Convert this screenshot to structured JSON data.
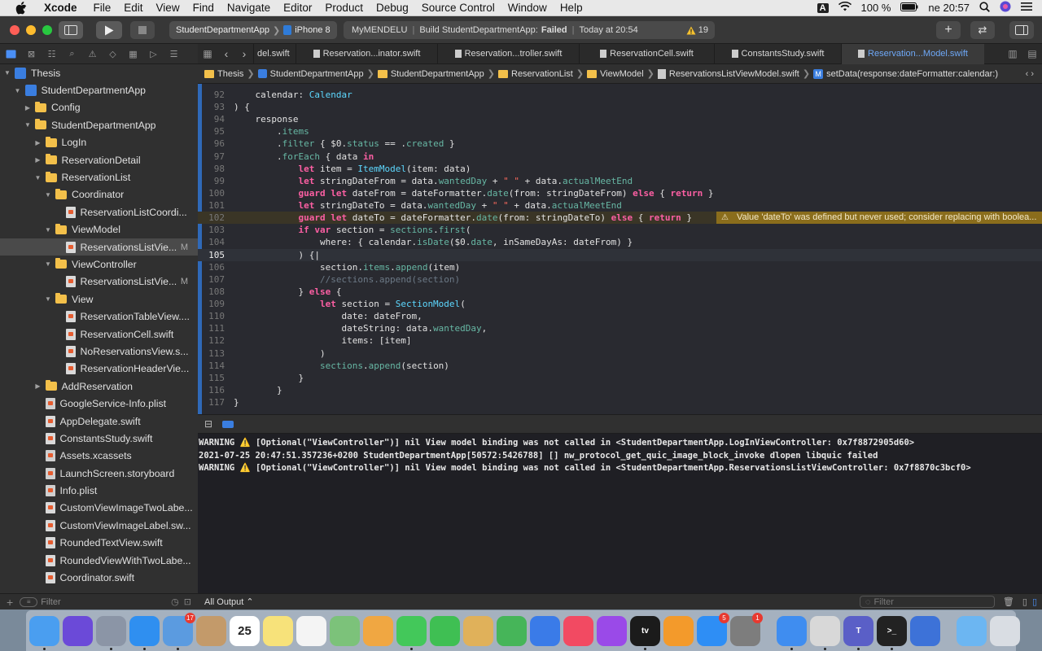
{
  "menubar": {
    "app": "Xcode",
    "items": [
      "File",
      "Edit",
      "View",
      "Find",
      "Navigate",
      "Editor",
      "Product",
      "Debug",
      "Source Control",
      "Window",
      "Help"
    ],
    "input_source": "A",
    "battery": "100 %",
    "clock": "ne 20:57"
  },
  "toolbar": {
    "scheme_target": "StudentDepartmentApp",
    "scheme_device": "iPhone 8",
    "status_project": "MyMENDELU",
    "status_text_prefix": "Build StudentDepartmentApp:",
    "status_result": "Failed",
    "status_time": "Today at 20:54",
    "warning_count": "19"
  },
  "sidebar": {
    "items": [
      {
        "label": "Thesis",
        "kind": "project",
        "indent": 0,
        "open": true
      },
      {
        "label": "StudentDepartmentApp",
        "kind": "project",
        "indent": 1,
        "open": true
      },
      {
        "label": "Config",
        "kind": "folder",
        "indent": 2,
        "open": false
      },
      {
        "label": "StudentDepartmentApp",
        "kind": "folder",
        "indent": 2,
        "open": true
      },
      {
        "label": "LogIn",
        "kind": "folder",
        "indent": 3,
        "open": false
      },
      {
        "label": "ReservationDetail",
        "kind": "folder",
        "indent": 3,
        "open": false
      },
      {
        "label": "ReservationList",
        "kind": "folder",
        "indent": 3,
        "open": true
      },
      {
        "label": "Coordinator",
        "kind": "folder",
        "indent": 4,
        "open": true
      },
      {
        "label": "ReservationListCoordi...",
        "kind": "swift",
        "indent": 5
      },
      {
        "label": "ViewModel",
        "kind": "folder",
        "indent": 4,
        "open": true
      },
      {
        "label": "ReservationsListVie...",
        "kind": "swift",
        "indent": 5,
        "badge": "M",
        "selected": true
      },
      {
        "label": "ViewController",
        "kind": "folder",
        "indent": 4,
        "open": true
      },
      {
        "label": "ReservationsListVie...",
        "kind": "swift",
        "indent": 5,
        "badge": "M"
      },
      {
        "label": "View",
        "kind": "folder",
        "indent": 4,
        "open": true
      },
      {
        "label": "ReservationTableView....",
        "kind": "swift",
        "indent": 5
      },
      {
        "label": "ReservationCell.swift",
        "kind": "swift",
        "indent": 5
      },
      {
        "label": "NoReservationsView.s...",
        "kind": "swift",
        "indent": 5
      },
      {
        "label": "ReservationHeaderVie...",
        "kind": "swift",
        "indent": 5
      },
      {
        "label": "AddReservation",
        "kind": "folder",
        "indent": 3,
        "open": false
      },
      {
        "label": "GoogleService-Info.plist",
        "kind": "plist",
        "indent": 3
      },
      {
        "label": "AppDelegate.swift",
        "kind": "swift",
        "indent": 3
      },
      {
        "label": "ConstantsStudy.swift",
        "kind": "swift",
        "indent": 3
      },
      {
        "label": "Assets.xcassets",
        "kind": "plist",
        "indent": 3
      },
      {
        "label": "LaunchScreen.storyboard",
        "kind": "plist",
        "indent": 3
      },
      {
        "label": "Info.plist",
        "kind": "plist",
        "indent": 3
      },
      {
        "label": "CustomViewImageTwoLabe...",
        "kind": "swift",
        "indent": 3
      },
      {
        "label": "CustomViewImageLabel.sw...",
        "kind": "swift",
        "indent": 3
      },
      {
        "label": "RoundedTextView.swift",
        "kind": "swift",
        "indent": 3
      },
      {
        "label": "RoundedViewWithTwoLabe...",
        "kind": "swift",
        "indent": 3
      },
      {
        "label": "Coordinator.swift",
        "kind": "swift",
        "indent": 3
      }
    ],
    "filter_placeholder": "Filter"
  },
  "tabs": [
    {
      "label": "del.swift",
      "active": false
    },
    {
      "label": "Reservation...inator.swift",
      "active": false
    },
    {
      "label": "Reservation...troller.swift",
      "active": false
    },
    {
      "label": "ReservationCell.swift",
      "active": false
    },
    {
      "label": "ConstantsStudy.swift",
      "active": false
    },
    {
      "label": "Reservation...Model.swift",
      "active": true
    }
  ],
  "jumpbar": [
    "Thesis",
    "StudentDepartmentApp",
    "StudentDepartmentApp",
    "ReservationList",
    "ViewModel",
    "ReservationsListViewModel.swift",
    "setData(response:dateFormatter:calendar:)"
  ],
  "editor": {
    "warning_message": "Value 'dateTo' was defined but never used; consider replacing with boolea...",
    "lines": [
      {
        "n": "92",
        "html": "    calendar: <span class=\"t\">Calendar</span>"
      },
      {
        "n": "93",
        "html": ") {"
      },
      {
        "n": "94",
        "html": "    response"
      },
      {
        "n": "95",
        "html": "        .<span class=\"f\">items</span>"
      },
      {
        "n": "96",
        "html": "        .<span class=\"f\">filter</span> { $0.<span class=\"f\">status</span> == .<span class=\"f\">created</span> }"
      },
      {
        "n": "97",
        "html": "        .<span class=\"f\">forEach</span> { data <span class=\"k\">in</span>"
      },
      {
        "n": "98",
        "html": "            <span class=\"k\">let</span> item = <span class=\"t\">ItemModel</span>(item: data)"
      },
      {
        "n": "99",
        "html": "            <span class=\"k\">let</span> stringDateFrom = data.<span class=\"f\">wantedDay</span> + <span class=\"s\">\" \"</span> + data.<span class=\"f\">actualMeetEnd</span>"
      },
      {
        "n": "100",
        "html": "            <span class=\"k\">guard let</span> dateFrom = dateFormatter.<span class=\"f\">date</span>(from: stringDateFrom) <span class=\"k\">else</span> { <span class=\"k\">return</span> }"
      },
      {
        "n": "101",
        "html": "            <span class=\"k\">let</span> stringDateTo = data.<span class=\"f\">wantedDay</span> + <span class=\"s\">\" \"</span> + data.<span class=\"f\">actualMeetEnd</span>"
      },
      {
        "n": "102",
        "html": "            <span class=\"k\">guard let</span> dateTo = dateFormatter.<span class=\"f\">date</span>(from: stringDateTo) <span class=\"k\">else</span> { <span class=\"k\">return</span> }",
        "warn": true
      },
      {
        "n": "103",
        "html": "            <span class=\"k\">if var</span> section = <span class=\"f\">sections</span>.<span class=\"f\">first</span>("
      },
      {
        "n": "104",
        "html": "                where: { calendar.<span class=\"f\">isDate</span>($0.<span class=\"f\">date</span>, inSameDayAs: dateFrom) }"
      },
      {
        "n": "105",
        "html": "            ) {|",
        "cur": true
      },
      {
        "n": "106",
        "html": "                section.<span class=\"f\">items</span>.<span class=\"f\">append</span>(item)"
      },
      {
        "n": "107",
        "html": "                <span class=\"c\">//sections.append(section)</span>"
      },
      {
        "n": "108",
        "html": "            } <span class=\"k\">else</span> {"
      },
      {
        "n": "109",
        "html": "                <span class=\"k\">let</span> section = <span class=\"t\">SectionModel</span>("
      },
      {
        "n": "110",
        "html": "                    date: dateFrom,"
      },
      {
        "n": "111",
        "html": "                    dateString: data.<span class=\"f\">wantedDay</span>,"
      },
      {
        "n": "112",
        "html": "                    items: [item]"
      },
      {
        "n": "113",
        "html": "                )"
      },
      {
        "n": "114",
        "html": "                <span class=\"f\">sections</span>.<span class=\"f\">append</span>(section)"
      },
      {
        "n": "115",
        "html": "            }"
      },
      {
        "n": "116",
        "html": "        }"
      },
      {
        "n": "117",
        "html": "}"
      }
    ]
  },
  "console": {
    "lines": [
      "WARNING ⚠️ [Optional(\"ViewController\")]  nil  View model binding was not called in <StudentDepartmentApp.LogInViewController: 0x7f8872905d60>",
      "2021-07-25 20:47:51.357236+0200 StudentDepartmentApp[50572:5426788] [] nw_protocol_get_quic_image_block_invoke dlopen libquic failed",
      "WARNING ⚠️ [Optional(\"ViewController\")]  nil  View model binding was not called in <StudentDepartmentApp.ReservationsListViewController: 0x7f8870c3bcf0>"
    ],
    "output_selector": "All Output ⌃",
    "filter_placeholder": "Filter"
  },
  "dock": {
    "apps": [
      {
        "name": "finder-icon",
        "color": "#4a9ef0",
        "label": ""
      },
      {
        "name": "siri-icon",
        "color": "#6b4ad8",
        "label": ""
      },
      {
        "name": "launchpad-icon",
        "color": "#8b95a6",
        "label": ""
      },
      {
        "name": "safari-icon",
        "color": "#2f8ff0",
        "label": ""
      },
      {
        "name": "mail-icon",
        "color": "#5b9be0",
        "label": "",
        "badge": "17"
      },
      {
        "name": "contacts-icon",
        "color": "#c39a6a",
        "label": ""
      },
      {
        "name": "calendar-icon",
        "color": "#ffffff",
        "label": "25"
      },
      {
        "name": "notes-icon",
        "color": "#f7e27a",
        "label": ""
      },
      {
        "name": "reminders-icon",
        "color": "#f4f4f4",
        "label": ""
      },
      {
        "name": "maps-icon",
        "color": "#7cc27a",
        "label": ""
      },
      {
        "name": "photos-icon",
        "color": "#f0a742",
        "label": ""
      },
      {
        "name": "messages-icon",
        "color": "#43c85a",
        "label": ""
      },
      {
        "name": "facetime-icon",
        "color": "#3fbf53",
        "label": ""
      },
      {
        "name": "preview-icon",
        "color": "#e0b15a",
        "label": ""
      },
      {
        "name": "numbers-icon",
        "color": "#46b559",
        "label": ""
      },
      {
        "name": "keynote-icon",
        "color": "#3a7be8",
        "label": ""
      },
      {
        "name": "music-icon",
        "color": "#f24a62",
        "label": ""
      },
      {
        "name": "podcasts-icon",
        "color": "#9a4ae8",
        "label": ""
      },
      {
        "name": "tv-icon",
        "color": "#1b1b1b",
        "label": "tv"
      },
      {
        "name": "books-icon",
        "color": "#f39a2b",
        "label": ""
      },
      {
        "name": "appstore-icon",
        "color": "#2e8ef5",
        "label": "",
        "badge": "5"
      },
      {
        "name": "system-preferences-icon",
        "color": "#7d7d7d",
        "label": "",
        "badge": "1"
      },
      {
        "name": "xcode-icon",
        "color": "#3f8df0",
        "label": ""
      },
      {
        "name": "disk-utility-icon",
        "color": "#d8d8d8",
        "label": ""
      },
      {
        "name": "teams-icon",
        "color": "#5a5fc7",
        "label": "T"
      },
      {
        "name": "terminal-icon",
        "color": "#222222",
        "label": ">_"
      },
      {
        "name": "instruments-icon",
        "color": "#3d72d8",
        "label": ""
      },
      {
        "name": "downloads-folder-icon",
        "color": "#6cb6f2",
        "label": ""
      },
      {
        "name": "trash-icon",
        "color": "#d9dde3",
        "label": ""
      }
    ]
  }
}
